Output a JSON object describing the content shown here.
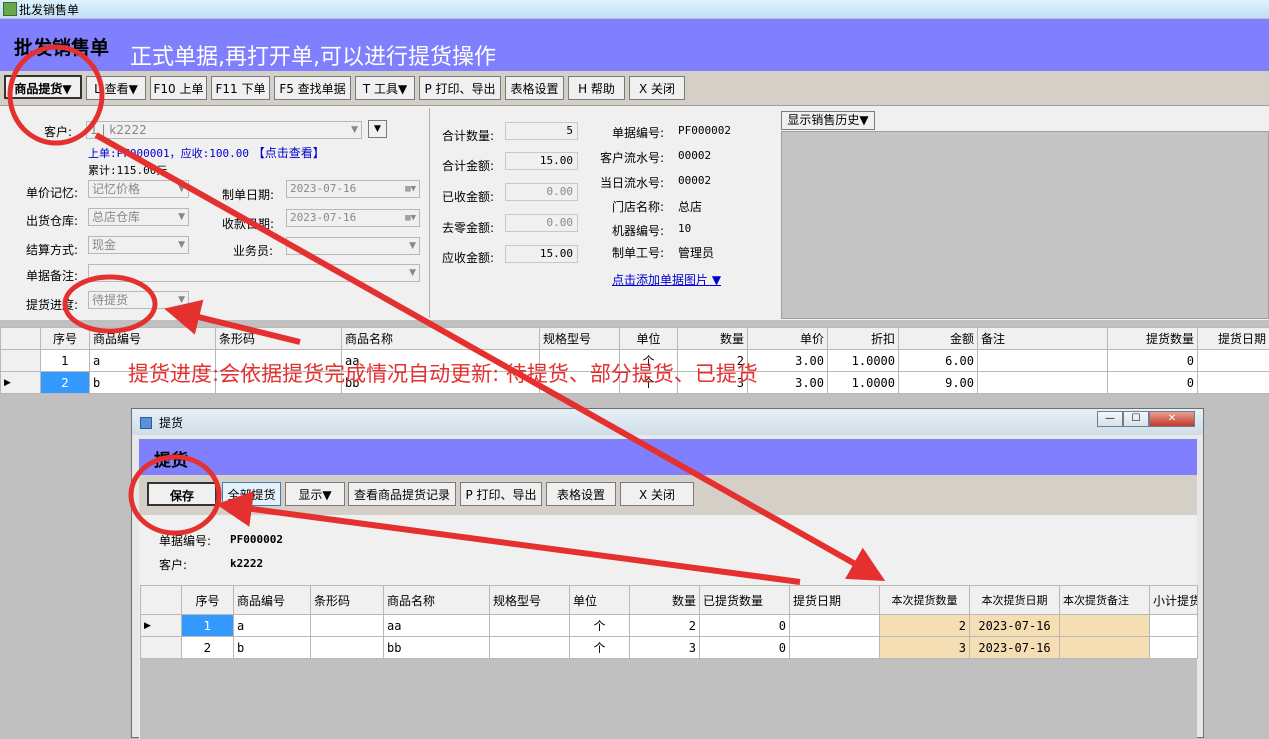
{
  "window": {
    "title": "批发销售单"
  },
  "header": {
    "title": "批发销售单",
    "annotation": "正式单据,再打开单,可以进行提货操作"
  },
  "toolbar": {
    "buttons": [
      "商品提货▼",
      "L 查看▼",
      "F10 上单",
      "F11 下单",
      "F5 查找单据",
      "T 工具▼",
      "P 打印、导出",
      "表格设置",
      "H 帮助",
      "X 关闭"
    ]
  },
  "form": {
    "customer_label": "客户:",
    "customer_value": "k2222",
    "customer_prefix": "1",
    "prev_bill": "上单:PF000001，应收:100.00",
    "click_view": "【点击查看】",
    "cumulative": "累计:115.00元",
    "price_memory_label": "单价记忆:",
    "price_memory_value": "记忆价格",
    "warehouse_label": "出货仓库:",
    "warehouse_value": "总店仓库",
    "settlement_label": "结算方式:",
    "settlement_value": "现金",
    "remark_label": "单据备注:",
    "progress_label": "提货进度:",
    "progress_value": "待提货",
    "make_date_label": "制单日期:",
    "make_date_value": "2023-07-16",
    "receive_date_label": "收款日期:",
    "receive_date_value": "2023-07-16",
    "salesman_label": "业务员:"
  },
  "totals": {
    "qty_label": "合计数量:",
    "qty": "5",
    "amount_label": "合计金额:",
    "amount": "15.00",
    "received_label": "已收金额:",
    "received": "0.00",
    "rounding_label": "去零金额:",
    "rounding": "0.00",
    "receivable_label": "应收金额:",
    "receivable": "15.00"
  },
  "info": {
    "bill_no_label": "单据编号:",
    "bill_no": "PF000002",
    "cust_serial_label": "客户流水号:",
    "cust_serial": "00002",
    "day_serial_label": "当日流水号:",
    "day_serial": "00002",
    "store_label": "门店名称:",
    "store": "总店",
    "machine_label": "机器编号:",
    "machine": "10",
    "operator_label": "制单工号:",
    "operator": "管理员",
    "add_image": "点击添加单据图片 ▼"
  },
  "history_button": "显示销售历史▼",
  "main_grid": {
    "headers": [
      "序号",
      "商品编号",
      "条形码",
      "商品名称",
      "规格型号",
      "单位",
      "数量",
      "单价",
      "折扣",
      "金额",
      "备注",
      "提货数量",
      "提货日期"
    ],
    "rows": [
      [
        "1",
        "a",
        "",
        "aa",
        "",
        "个",
        "2",
        "3.00",
        "1.0000",
        "6.00",
        "",
        "0",
        ""
      ],
      [
        "2",
        "b",
        "",
        "bb",
        "",
        "个",
        "3",
        "3.00",
        "1.0000",
        "9.00",
        "",
        "0",
        ""
      ]
    ]
  },
  "annotation_progress": "提货进度:会依据提货完成情况自动更新: 待提货、部分提货、已提货",
  "dialog": {
    "title": "提货",
    "header": "提货",
    "buttons": [
      "保存",
      "全部提货",
      "显示▼",
      "查看商品提货记录",
      "P 打印、导出",
      "表格设置",
      "X 关闭"
    ],
    "bill_no_label": "单据编号:",
    "bill_no": "PF000002",
    "customer_label": "客户:",
    "customer": "k2222",
    "grid_headers": [
      "序号",
      "商品编号",
      "条形码",
      "商品名称",
      "规格型号",
      "单位",
      "数量",
      "已提货数量",
      "提货日期",
      "本次提货数量",
      "本次提货日期",
      "本次提货备注",
      "小计提货"
    ],
    "rows": [
      [
        "1",
        "a",
        "",
        "aa",
        "",
        "个",
        "2",
        "0",
        "",
        "2",
        "2023-07-16",
        "",
        ""
      ],
      [
        "2",
        "b",
        "",
        "bb",
        "",
        "个",
        "3",
        "0",
        "",
        "3",
        "2023-07-16",
        "",
        ""
      ]
    ]
  },
  "colors": {
    "header_bg": "#8080ff",
    "annotation_red": "#e53030",
    "highlight": "#f5deb3",
    "selected": "#3399ff"
  }
}
